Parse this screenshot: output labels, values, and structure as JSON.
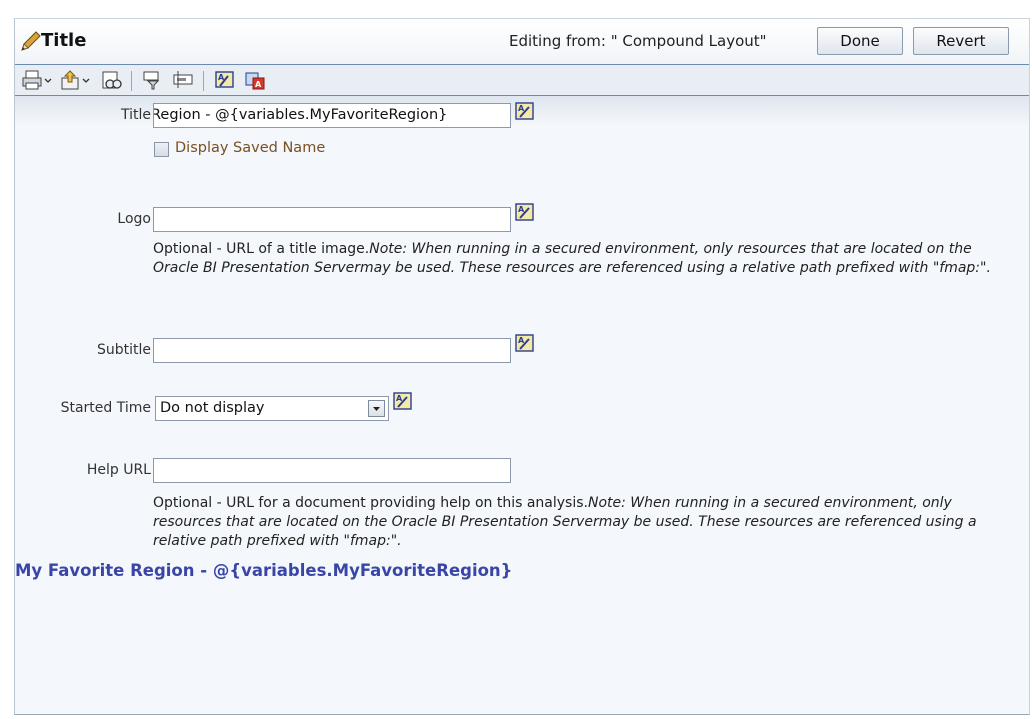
{
  "header": {
    "title": "Title",
    "editing_from": "Editing from: \" Compound Layout\"",
    "done_label": "Done",
    "revert_label": "Revert"
  },
  "toolbar": {
    "icons": [
      "print-icon",
      "export-icon",
      "preview-icon",
      "filter-icon",
      "prompt-icon",
      "format-icon",
      "format-clear-icon"
    ]
  },
  "form": {
    "title_label": "Title",
    "title_value": "Region - @{variables.MyFavoriteRegion}",
    "display_saved_name_label": "Display Saved Name",
    "display_saved_name_checked": false,
    "logo_label": "Logo",
    "logo_value": "",
    "logo_note_plain": "Optional - URL of a title image.",
    "logo_note_italic": "Note: When running in a secured environment, only resources that are located on the Oracle BI Presentation Servermay be used. These resources are referenced using a relative path prefixed with \"fmap:\".",
    "subtitle_label": "Subtitle",
    "subtitle_value": "",
    "started_time_label": "Started Time",
    "started_time_value": "Do not display",
    "help_url_label": "Help URL",
    "help_url_value": "",
    "help_note_plain": "Optional - URL for a document providing help on this analysis.",
    "help_note_italic": "Note: When running in a secured environment, only resources that are located on the Oracle BI Presentation Servermay be used. These resources are referenced using a relative path prefixed with \"fmap:\"."
  },
  "preview": {
    "text": "My Favorite Region - @{variables.MyFavoriteRegion}"
  },
  "colors": {
    "preview_text": "#3a45a8",
    "checkbox_label": "#7a4f22"
  }
}
